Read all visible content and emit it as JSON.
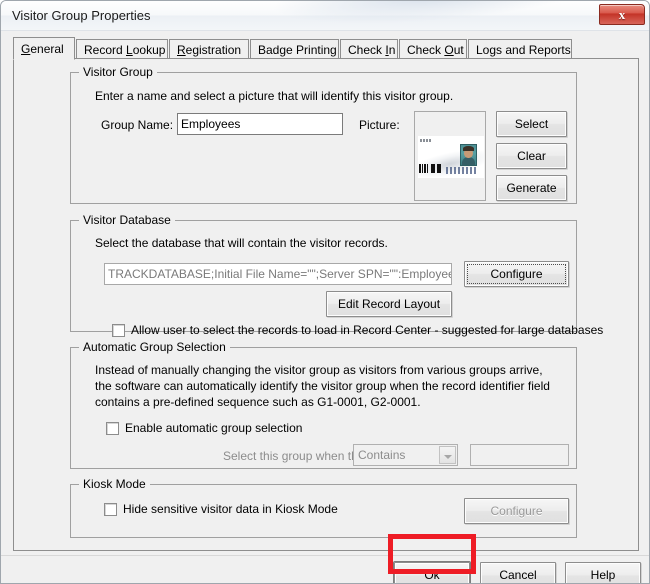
{
  "window": {
    "title": "Visitor Group Properties",
    "close_icon": "close-icon",
    "close_glyph": "x"
  },
  "tabs": [
    {
      "label": "General",
      "acc": "G",
      "selected": true
    },
    {
      "label": "Record Lookup",
      "acc": "L",
      "selected": false
    },
    {
      "label": "Registration",
      "acc": "R",
      "selected": false
    },
    {
      "label": "Badge Printing",
      "acc": "",
      "selected": false
    },
    {
      "label": "Check In",
      "acc": "I",
      "selected": false
    },
    {
      "label": "Check Out",
      "acc": "O",
      "selected": false
    },
    {
      "label": "Logs and Reports",
      "acc": "g",
      "selected": false
    }
  ],
  "visitor_group": {
    "title": "Visitor Group",
    "description": "Enter a name and select a picture that will identify this visitor group.",
    "group_name_label": "Group Name:",
    "group_name_value": "Employees",
    "group_name_placeholder": "",
    "picture_label": "Picture:",
    "buttons": {
      "select": "Select",
      "clear": "Clear",
      "generate": "Generate"
    }
  },
  "visitor_database": {
    "title": "Visitor Database",
    "description": "Select the database that will contain the visitor records.",
    "connection_value": "TRACKDATABASE;Initial File Name=\"\";Server SPN=\"\":Employee",
    "connection_placeholder": "",
    "configure_label": "Configure",
    "edit_record_layout_label": "Edit Record Layout",
    "allow_user_checkbox_label": "Allow user to select the records to load in Record Center - suggested for large databases",
    "allow_user_checked": false
  },
  "automatic_group_selection": {
    "title": "Automatic Group Selection",
    "description": "Instead of manually changing the visitor group as visitors from various groups arrive, the software can automatically identify the visitor group when the record identifier field contains a pre-defined sequence such as G1-0001, G2-0001.",
    "enable_checkbox_label": "Enable automatic group selection",
    "enable_checked": false,
    "select_group_label": "Select this group when the ID field",
    "condition_value": "Contains",
    "condition_options": [
      "Contains"
    ],
    "match_value": "",
    "match_placeholder": ""
  },
  "kiosk_mode": {
    "title": "Kiosk Mode",
    "hide_checkbox_label": "Hide sensitive visitor data in Kiosk Mode",
    "hide_checked": false,
    "configure_label": "Configure",
    "configure_disabled": true
  },
  "footer": {
    "ok_label": "Ok",
    "cancel_label": "Cancel",
    "help_label": "Help"
  },
  "annotation": {
    "highlight_color": "#ee1c25",
    "target": "ok-button"
  }
}
